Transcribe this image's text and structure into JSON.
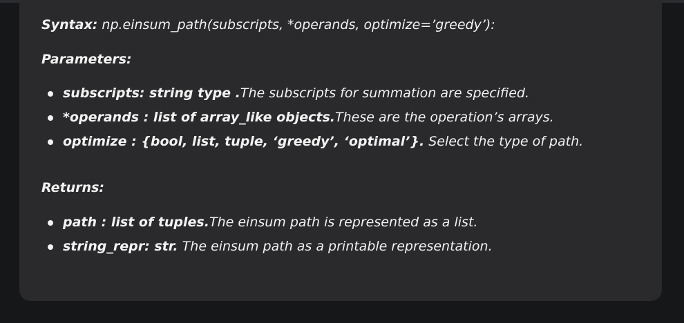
{
  "syntax": {
    "label": "Syntax:",
    "text": " np.einsum_path(subscripts, *operands, optimize=’greedy’):"
  },
  "parameters": {
    "heading": "Parameters:",
    "items": [
      {
        "term": "subscripts: string type .",
        "desc": "The subscripts for summation are specified."
      },
      {
        "term": "*operands : list of array_like objects.",
        "desc": "These are the operation’s arrays."
      },
      {
        "term": "optimize : {bool, list, tuple, ‘greedy’, ‘optimal’}.",
        "desc": " Select the type of path."
      }
    ]
  },
  "returns": {
    "heading": "Returns:",
    "items": [
      {
        "term": "path : list of tuples.",
        "desc": "The einsum path is represented as a list."
      },
      {
        "term": "string_repr: str.",
        "desc": " The einsum path as a printable representation."
      }
    ]
  }
}
